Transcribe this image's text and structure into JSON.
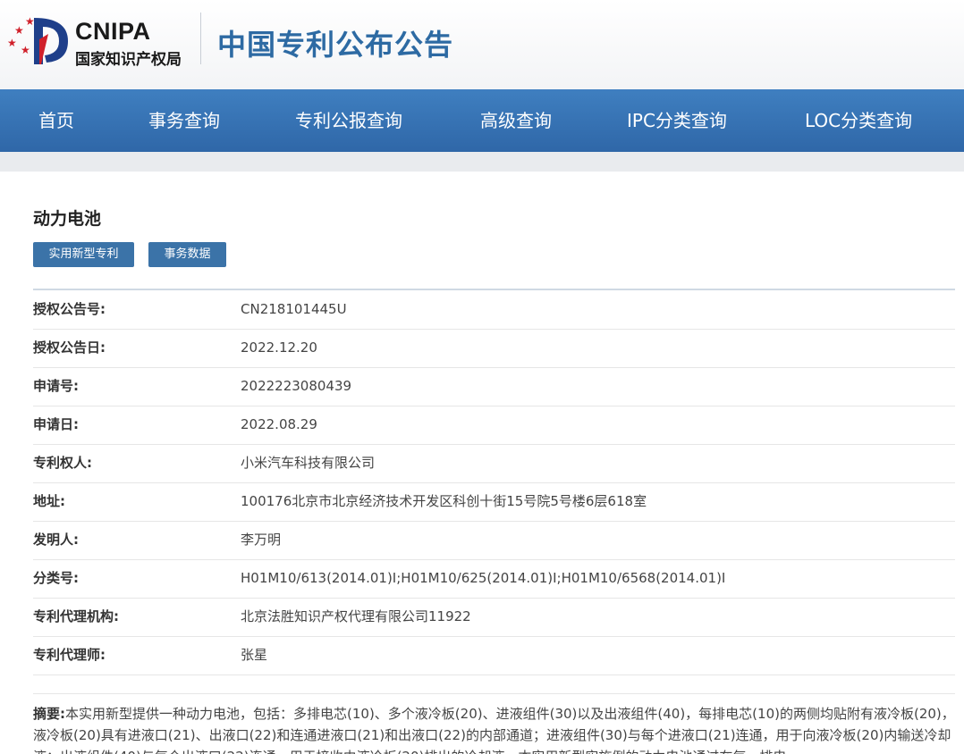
{
  "header": {
    "logo_en": "CNIPA",
    "logo_cn": "国家知识产权局",
    "site_title": "中国专利公布公告"
  },
  "nav": {
    "items": [
      {
        "label": "首页"
      },
      {
        "label": "事务查询"
      },
      {
        "label": "专利公报查询"
      },
      {
        "label": "高级查询"
      },
      {
        "label": "IPC分类查询"
      },
      {
        "label": "LOC分类查询"
      }
    ]
  },
  "patent": {
    "title": "动力电池",
    "tags": [
      "实用新型专利",
      "事务数据"
    ],
    "fields": [
      {
        "label": "授权公告号:",
        "value": "CN218101445U"
      },
      {
        "label": "授权公告日:",
        "value": "2022.12.20"
      },
      {
        "label": "申请号:",
        "value": "2022223080439"
      },
      {
        "label": "申请日:",
        "value": "2022.08.29"
      },
      {
        "label": "专利权人:",
        "value": "小米汽车科技有限公司"
      },
      {
        "label": "地址:",
        "value": "100176北京市北京经济技术开发区科创十街15号院5号楼6层618室"
      },
      {
        "label": "发明人:",
        "value": "李万明"
      },
      {
        "label": "分类号:",
        "value": "H01M10/613(2014.01)I;H01M10/625(2014.01)I;H01M10/6568(2014.01)I"
      },
      {
        "label": "专利代理机构:",
        "value": "北京法胜知识产权代理有限公司11922"
      },
      {
        "label": "专利代理师:",
        "value": "张星"
      }
    ],
    "abstract_label": "摘要:",
    "abstract_text": "本实用新型提供一种动力电池，包括：多排电芯(10)、多个液冷板(20)、进液组件(30)以及出液组件(40)，每排电芯(10)的两侧均贴附有液冷板(20)，液冷板(20)具有进液口(21)、出液口(22)和连通进液口(21)和出液口(22)的内部通道；进液组件(30)与每个进液口(21)连通，用于向液冷板(20)内输送冷却液；出液组件(40)与每个出液口(22)连通，用于接收由液冷板(20)排出的冷却液。本实用新型实施例的动力电池通过在每一排电"
  },
  "colors": {
    "brand_blue": "#2d6aa3",
    "nav_blue": "#3473b4",
    "button_blue": "#3b73a8",
    "logo_red": "#d0202a"
  }
}
